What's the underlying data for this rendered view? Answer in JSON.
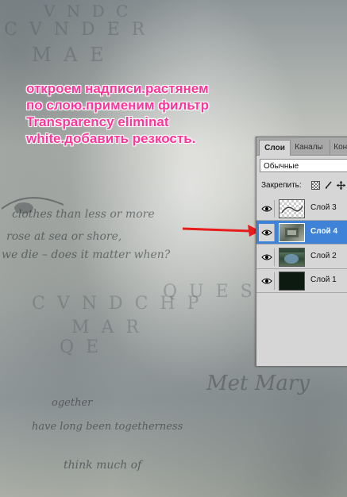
{
  "instruction": {
    "lines": [
      "откроем надписи.растянем",
      "по слою.применим фильтр",
      "Transparency eliminat",
      "white.добавить резкость."
    ],
    "color": "#ff3399"
  },
  "background_text": {
    "big1": "V N D C",
    "big2": "C V N D E R",
    "big3": "M A E",
    "big4": "Q U E S",
    "big5": "C V N D C H P",
    "big6": "M A R",
    "big7": "Q E",
    "script1": "clothes   than less or more",
    "script2": "rose   at sea or shore,",
    "script3": "we die – does it matter when?",
    "script4": "Met Mary",
    "script5": "ogether",
    "script6": "have long been togetherness",
    "script7": "think much of"
  },
  "panel": {
    "tabs": [
      "Слои",
      "Каналы",
      "Конт"
    ],
    "blend_mode": "Обычные",
    "lock_label": "Закрепить:",
    "layers": [
      {
        "name": "Слой 3",
        "selected": false,
        "visible": true
      },
      {
        "name": "Слой 4",
        "selected": true,
        "visible": true
      },
      {
        "name": "Слой 2",
        "selected": false,
        "visible": true
      },
      {
        "name": "Слой 1",
        "selected": false,
        "visible": true
      }
    ],
    "selection_color": "#3f83d8"
  },
  "arrow": {
    "color": "#e81c1c"
  },
  "icons": {
    "eye": "eye-icon",
    "lock_transparency": "checkerboard-lock-icon",
    "lock_paint": "brush-lock-icon",
    "lock_move": "move-lock-icon"
  }
}
